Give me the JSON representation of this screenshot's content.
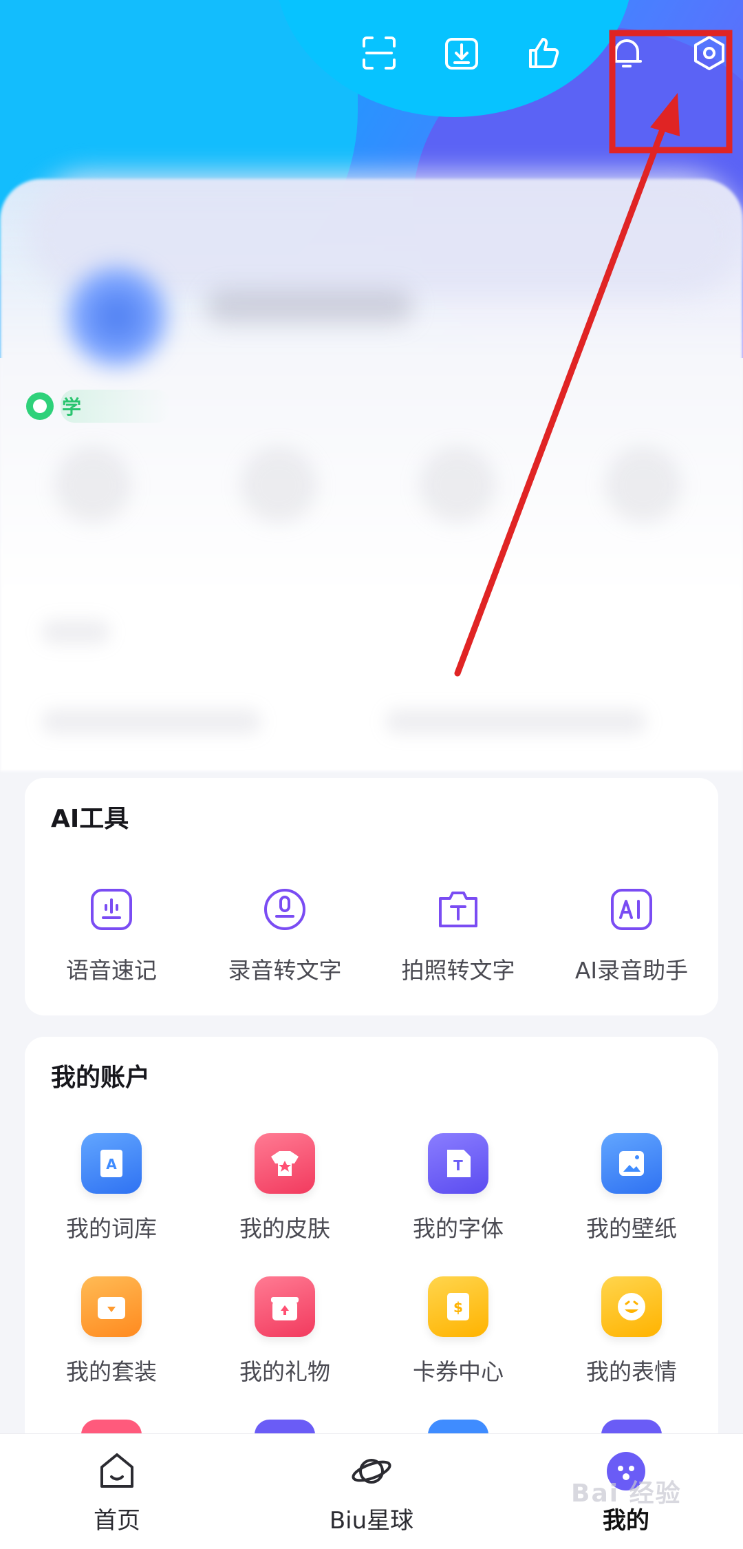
{
  "header": {
    "icons": [
      "scan-icon",
      "download-icon",
      "thumbs-up-icon",
      "bell-icon",
      "settings-icon"
    ]
  },
  "profile": {
    "tag_text": "学"
  },
  "ai_tools": {
    "title": "AI工具",
    "items": [
      {
        "label": "语音速记",
        "icon": "voice-memo-icon"
      },
      {
        "label": "录音转文字",
        "icon": "record-to-text-icon"
      },
      {
        "label": "拍照转文字",
        "icon": "photo-to-text-icon"
      },
      {
        "label": "AI录音助手",
        "icon": "ai-recorder-icon"
      }
    ]
  },
  "account": {
    "title": "我的账户",
    "items": [
      {
        "label": "我的词库",
        "icon": "lexicon-icon",
        "color": "#3f8cff"
      },
      {
        "label": "我的皮肤",
        "icon": "skin-icon",
        "color": "#ff4f72"
      },
      {
        "label": "我的字体",
        "icon": "font-icon",
        "color": "#6a5cf6"
      },
      {
        "label": "我的壁纸",
        "icon": "wallpaper-icon",
        "color": "#3f8cff"
      },
      {
        "label": "我的套装",
        "icon": "suite-icon",
        "color": "#ff9a2e"
      },
      {
        "label": "我的礼物",
        "icon": "gift-icon",
        "color": "#ff4f72"
      },
      {
        "label": "卡券中心",
        "icon": "coupon-icon",
        "color": "#ffc21a"
      },
      {
        "label": "我的表情",
        "icon": "emoji-icon",
        "color": "#ffc21a"
      }
    ]
  },
  "bottom_nav": {
    "items": [
      {
        "label": "首页",
        "icon": "home-icon"
      },
      {
        "label": "Biu星球",
        "icon": "planet-icon"
      },
      {
        "label": "我的",
        "icon": "me-icon",
        "active": true
      }
    ]
  },
  "watermark": "Bai 经验",
  "colors": {
    "accent": "#6a5cf6",
    "annotation": "#e02424"
  }
}
